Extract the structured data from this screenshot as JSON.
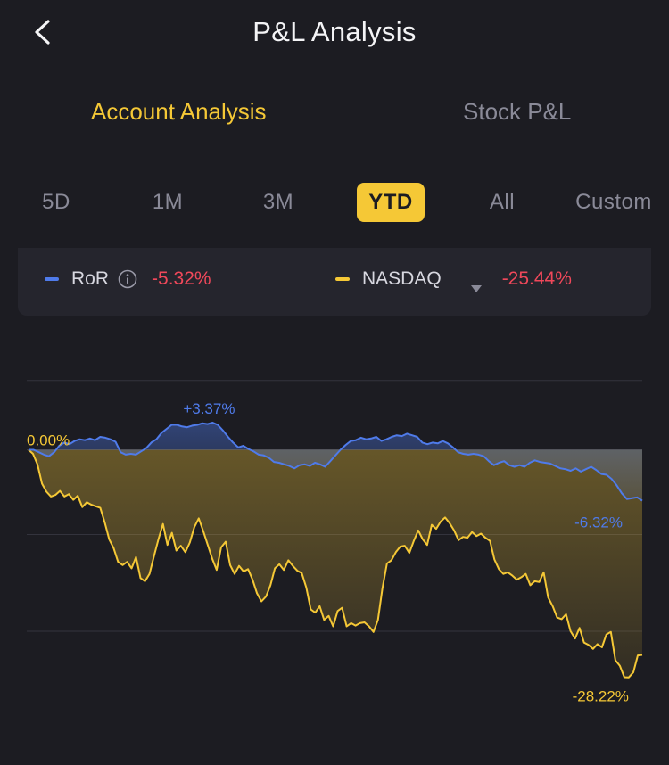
{
  "header": {
    "title": "P&L Analysis"
  },
  "mode_tabs": [
    {
      "label": "Account Analysis",
      "active": true
    },
    {
      "label": "Stock P&L",
      "active": false
    }
  ],
  "periods": [
    {
      "label": "5D",
      "active": false
    },
    {
      "label": "1M",
      "active": false
    },
    {
      "label": "3M",
      "active": false
    },
    {
      "label": "YTD",
      "active": true
    },
    {
      "label": "All",
      "active": false
    },
    {
      "label": "Custom",
      "active": false
    }
  ],
  "legend": {
    "ror": {
      "name": "RoR",
      "value": "-5.32%",
      "color": "#4f7bea"
    },
    "benchmark": {
      "name": "NASDAQ",
      "value": "-25.44%",
      "color": "#f5c836"
    }
  },
  "colors": {
    "accent": "#f5c836",
    "negative": "#f0485a",
    "background": "#1c1c22"
  },
  "chart_data": {
    "type": "line",
    "ylim": [
      -36,
      12
    ],
    "baseline_label": "0.00%",
    "annotations": {
      "ror_max": "+3.37%",
      "ror_last": "-6.32%",
      "benchmark_min": "-28.22%"
    },
    "series": [
      {
        "name": "RoR",
        "color": "#4f7bea",
        "values": [
          0,
          0,
          -0.3,
          -0.6,
          -0.8,
          -0.3,
          0.5,
          0.9,
          0.7,
          1.1,
          1.3,
          1.2,
          1.4,
          1.2,
          1.6,
          1.5,
          1.3,
          1.0,
          -0.3,
          -0.6,
          -0.5,
          -0.6,
          -0.2,
          0.2,
          0.9,
          1.3,
          2.1,
          2.6,
          3.1,
          3.1,
          2.9,
          2.8,
          3.0,
          3.1,
          3.3,
          3.2,
          3.37,
          3.1,
          2.4,
          1.6,
          0.9,
          0.3,
          0.5,
          0.1,
          -0.2,
          -0.6,
          -0.7,
          -1.0,
          -1.5,
          -1.6,
          -1.8,
          -2.0,
          -2.3,
          -1.9,
          -1.8,
          -2.0,
          -1.6,
          -1.8,
          -2.1,
          -1.4,
          -0.7,
          0,
          0.6,
          1.1,
          1.2,
          1.5,
          1.3,
          1.4,
          1.6,
          1.1,
          1.3,
          1.6,
          1.8,
          1.7,
          2.0,
          1.8,
          1.6,
          0.9,
          0.7,
          0.9,
          0.8,
          1.1,
          0.8,
          0.3,
          -0.3,
          -0.5,
          -0.6,
          -0.5,
          -0.6,
          -0.8,
          -1.4,
          -1.9,
          -1.6,
          -1.4,
          -1.9,
          -2.1,
          -1.9,
          -2.1,
          -1.6,
          -1.3,
          -1.5,
          -1.6,
          -1.7,
          -2.0,
          -2.3,
          -2.4,
          -2.6,
          -2.3,
          -2.7,
          -2.4,
          -2.1,
          -2.5,
          -3.0,
          -3.1,
          -3.6,
          -4.4,
          -5.4,
          -6.1,
          -6.0,
          -5.9,
          -6.32
        ]
      },
      {
        "name": "NASDAQ",
        "color": "#f5c836",
        "values": [
          0,
          -0.5,
          -1.8,
          -4.2,
          -5.2,
          -5.8,
          -5.6,
          -5.1,
          -5.8,
          -5.5,
          -6.2,
          -5.7,
          -7.1,
          -6.5,
          -6.8,
          -7.0,
          -7.2,
          -9.0,
          -11.1,
          -12.2,
          -13.9,
          -14.3,
          -13.9,
          -14.7,
          -13.3,
          -15.9,
          -16.3,
          -15.4,
          -13.2,
          -11.1,
          -9.2,
          -11.8,
          -10.3,
          -12.5,
          -11.9,
          -12.7,
          -11.5,
          -9.6,
          -8.5,
          -10.1,
          -11.8,
          -13.5,
          -14.9,
          -12.1,
          -11.4,
          -14.3,
          -15.4,
          -14.4,
          -15.1,
          -14.8,
          -16.1,
          -17.8,
          -18.8,
          -18.2,
          -16.8,
          -14.7,
          -14.2,
          -14.9,
          -13.7,
          -14.4,
          -15.0,
          -15.3,
          -17.1,
          -19.8,
          -20.2,
          -19.4,
          -21.1,
          -20.6,
          -21.9,
          -20.0,
          -19.6,
          -21.9,
          -21.5,
          -21.8,
          -21.5,
          -21.4,
          -21.9,
          -22.6,
          -21.1,
          -17.2,
          -14.1,
          -13.7,
          -12.7,
          -12.0,
          -11.9,
          -12.8,
          -11.3,
          -10.0,
          -11.1,
          -11.8,
          -9.3,
          -9.8,
          -8.9,
          -8.4,
          -9.1,
          -10.0,
          -11.2,
          -10.8,
          -10.9,
          -10.2,
          -10.7,
          -10.4,
          -10.9,
          -11.3,
          -13.6,
          -14.8,
          -15.4,
          -15.2,
          -15.6,
          -16.1,
          -15.8,
          -15.4,
          -16.8,
          -16.3,
          -16.4,
          -15.2,
          -18.3,
          -19.4,
          -20.8,
          -21.0,
          -20.4,
          -22.5,
          -23.4,
          -22.1,
          -23.9,
          -24.2,
          -24.7,
          -24.1,
          -24.5,
          -22.9,
          -22.6,
          -26.1,
          -26.8,
          -28.2,
          -28.22,
          -27.6,
          -25.5,
          -25.44
        ]
      }
    ]
  }
}
